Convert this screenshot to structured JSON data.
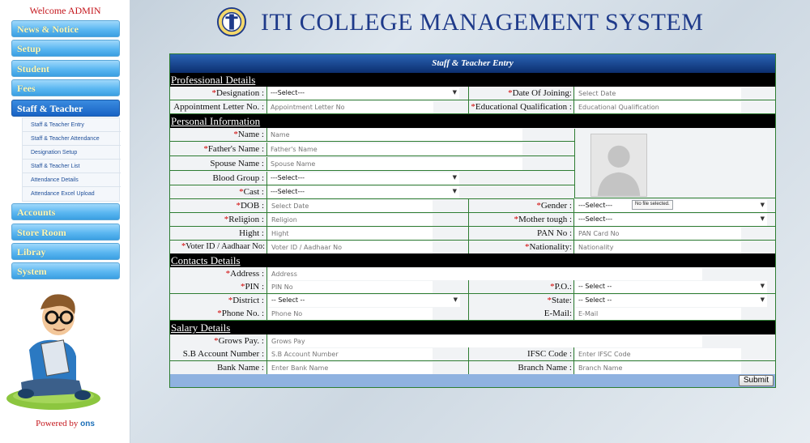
{
  "sidebar": {
    "welcome": "Welcome ADMIN",
    "menu": [
      {
        "label": "News & Notice"
      },
      {
        "label": "Setup"
      },
      {
        "label": "Student"
      },
      {
        "label": "Fees"
      },
      {
        "label": "Staff & Teacher"
      },
      {
        "label": "Accounts"
      },
      {
        "label": "Store Room"
      },
      {
        "label": "Libray"
      },
      {
        "label": "System"
      }
    ],
    "submenu": [
      {
        "label": "Staff & Teacher Entry"
      },
      {
        "label": "Staff & Teacher Attendance"
      },
      {
        "label": "Designation Setup"
      },
      {
        "label": "Staff & Teacher List"
      },
      {
        "label": "Attendance Details"
      },
      {
        "label": "Attendance Excel Upload"
      }
    ],
    "powered_by": "Powered by",
    "powered_brand": "ons"
  },
  "header": {
    "title": "ITI COLLEGE MANAGEMENT SYSTEM"
  },
  "form": {
    "title": "Staff & Teacher Entry",
    "sections": {
      "professional": "Professional Details",
      "personal": "Personal Information",
      "contacts": "Contacts Details",
      "salary": "Salary Details"
    },
    "fields": {
      "designation": {
        "label": "Designation :",
        "value": "---Select---"
      },
      "date_of_joining": {
        "label": "Date Of Joining:",
        "placeholder": "Select Date"
      },
      "appointment_letter": {
        "label": "Appointment Letter No. :",
        "placeholder": "Appointment Letter No"
      },
      "educational_qualification": {
        "label": "Educational Qualification :",
        "placeholder": "Educational Qualification"
      },
      "name": {
        "label": "Name :",
        "placeholder": "Name"
      },
      "fathers_name": {
        "label": "Father's Name :",
        "placeholder": "Father's Name"
      },
      "spouse_name": {
        "label": "Spouse Name :",
        "placeholder": "Spouse Name"
      },
      "blood_group": {
        "label": "Blood Group :",
        "value": "---Select---"
      },
      "cast": {
        "label": "Cast :",
        "value": "---Select---"
      },
      "dob": {
        "label": "DOB :",
        "placeholder": "Select Date"
      },
      "gender": {
        "label": "Gender :",
        "value": "---Select---"
      },
      "religion": {
        "label": "Religion :",
        "placeholder": "Religion"
      },
      "mother_tongue": {
        "label": "Mother tough :",
        "value": "---Select---"
      },
      "hight": {
        "label": "Hight :",
        "placeholder": "Hight"
      },
      "pan_no": {
        "label": "PAN No :",
        "placeholder": "PAN Card No"
      },
      "voter_id": {
        "label": "Voter ID / Aadhaar No:",
        "placeholder": "Voter ID / Aadhaar No"
      },
      "nationality": {
        "label": "Nationality:",
        "placeholder": "Nationality"
      },
      "address": {
        "label": "Address :",
        "placeholder": "Address"
      },
      "pin": {
        "label": "PIN :",
        "placeholder": "PIN No"
      },
      "po": {
        "label": "P.O.:",
        "value": "-- Select --"
      },
      "district": {
        "label": "District :",
        "value": "-- Select --"
      },
      "state": {
        "label": "State:",
        "value": "-- Select --"
      },
      "phone": {
        "label": "Phone No. :",
        "placeholder": "Phone No"
      },
      "email": {
        "label": "E-Mail:",
        "placeholder": "E-Mail"
      },
      "grows_pay": {
        "label": "Grows Pay. :",
        "placeholder": "Grows Pay"
      },
      "sb_account": {
        "label": "S.B Account Number :",
        "placeholder": "S.B Account Number"
      },
      "ifsc": {
        "label": "IFSC Code :",
        "placeholder": "Enter IFSC Code"
      },
      "bank_name": {
        "label": "Bank Name :",
        "placeholder": "Enter Bank Name"
      },
      "branch_name": {
        "label": "Branch Name :",
        "placeholder": "Branch Name"
      }
    },
    "photo": {
      "file_status": "No file selected."
    },
    "submit_label": "Submit"
  },
  "colors": {
    "accent": "#1e3a8a",
    "required": "#d00000",
    "menu_text": "#fff8b5",
    "active_menu": "#1863c4"
  }
}
